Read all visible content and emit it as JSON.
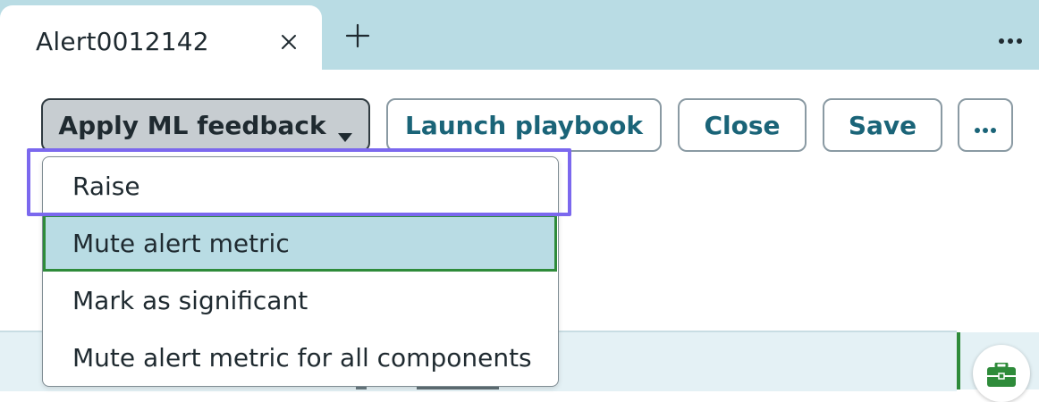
{
  "tabs": {
    "active_label": "Alert0012142",
    "close_icon": "close-icon",
    "add_icon": "plus-icon",
    "overflow_icon": "more-horizontal-icon"
  },
  "toolbar": {
    "apply_ml_feedback_label": "Apply ML feedback",
    "launch_playbook_label": "Launch playbook",
    "close_label": "Close",
    "save_label": "Save",
    "more_icon": "more-horizontal-icon"
  },
  "dropdown": {
    "items": [
      {
        "label": "Raise"
      },
      {
        "label": "Mute alert metric"
      },
      {
        "label": "Mark as significant"
      },
      {
        "label": "Mute alert metric for all components"
      }
    ],
    "selected_index": 1
  },
  "side_panel": {
    "briefcase_icon": "briefcase-icon"
  },
  "colors": {
    "tab_bar": "#b9dce4",
    "accent_text": "#1a6478",
    "selected_item_bg": "#b9dce4",
    "selected_item_border": "#2e8b3a",
    "highlight_outline": "#7b68ee",
    "briefcase_green": "#2e8b3a"
  }
}
